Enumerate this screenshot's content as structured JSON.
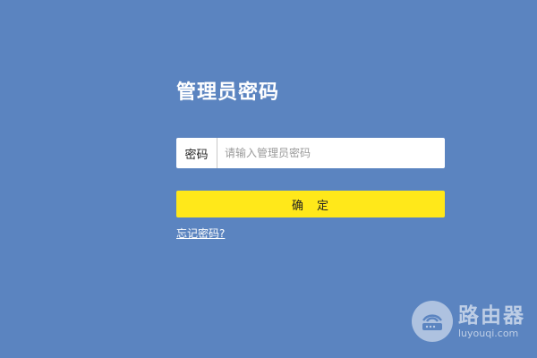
{
  "page": {
    "title": "管理员密码"
  },
  "password_field": {
    "label": "密码",
    "value": "",
    "placeholder": "请输入管理员密码"
  },
  "actions": {
    "confirm_label": "确　定",
    "forgot_label": "忘记密码?"
  },
  "watermark": {
    "name": "路由器",
    "url": "luyouqi.com",
    "icon": "router-icon"
  },
  "colors": {
    "background": "#5b84c0",
    "confirm_button": "#ffe81a",
    "text_light": "#ffffff"
  }
}
